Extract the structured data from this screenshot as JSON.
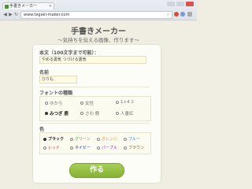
{
  "browser": {
    "tab_title": "手書きメーカー",
    "tab_close": "×",
    "url": "www.tegaki-maker.com",
    "back": "◀",
    "forward": "▶",
    "reload": "↻",
    "star": "☆"
  },
  "page": {
    "title": "手書きメーカー",
    "subtitle": "～気持ちを伝える画像、作ります～"
  },
  "form": {
    "body_label": "本文（100文字まで可能）：",
    "body_value": "やめる勇気 つづける勇気",
    "name_label": "名前",
    "name_value": "ひりも",
    "font_label": "フォントの種類",
    "fonts": [
      {
        "label": "ゆかろ",
        "selected": false
      },
      {
        "label": "女性",
        "selected": false
      },
      {
        "label": "1+4 2",
        "selected": false
      },
      {
        "label": "みつぎ 鹿",
        "selected": true
      },
      {
        "label": "さわ 鹿",
        "selected": false
      },
      {
        "label": "人番紅",
        "selected": false
      }
    ],
    "color_label": "色",
    "colors": [
      {
        "label": "ブラック",
        "selected": true,
        "hex": "#222222"
      },
      {
        "label": "グリーン",
        "selected": false,
        "hex": "#4a9d3a"
      },
      {
        "label": "オレンジ",
        "selected": false,
        "hex": "#e8842a"
      },
      {
        "label": "ブルー",
        "selected": false,
        "hex": "#3f7fd6"
      },
      {
        "label": "レッド",
        "selected": false,
        "hex": "#d83a3a"
      },
      {
        "label": "ネイビー",
        "selected": false,
        "hex": "#2b3f86"
      },
      {
        "label": "パープル",
        "selected": false,
        "hex": "#8a3fb3"
      },
      {
        "label": "ブラウン",
        "selected": false,
        "hex": "#8a5a2b"
      }
    ],
    "submit_label": "作る"
  }
}
